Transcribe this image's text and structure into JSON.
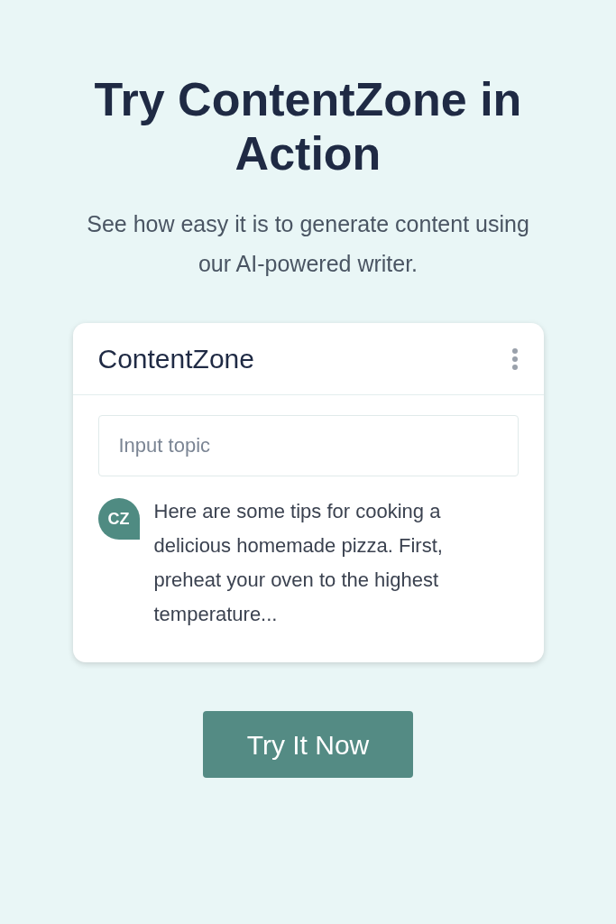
{
  "hero": {
    "title": "Try ContentZone in Action",
    "subtitle": "See how easy it is to generate content using our AI-powered writer."
  },
  "demo_card": {
    "title": "ContentZone",
    "input": {
      "placeholder": "Input topic"
    },
    "message": {
      "avatar": "CZ",
      "text": "Here are some tips for cooking a delicious homemade pizza. First, preheat your oven to the highest temperature..."
    }
  },
  "cta_button": "Try It Now"
}
